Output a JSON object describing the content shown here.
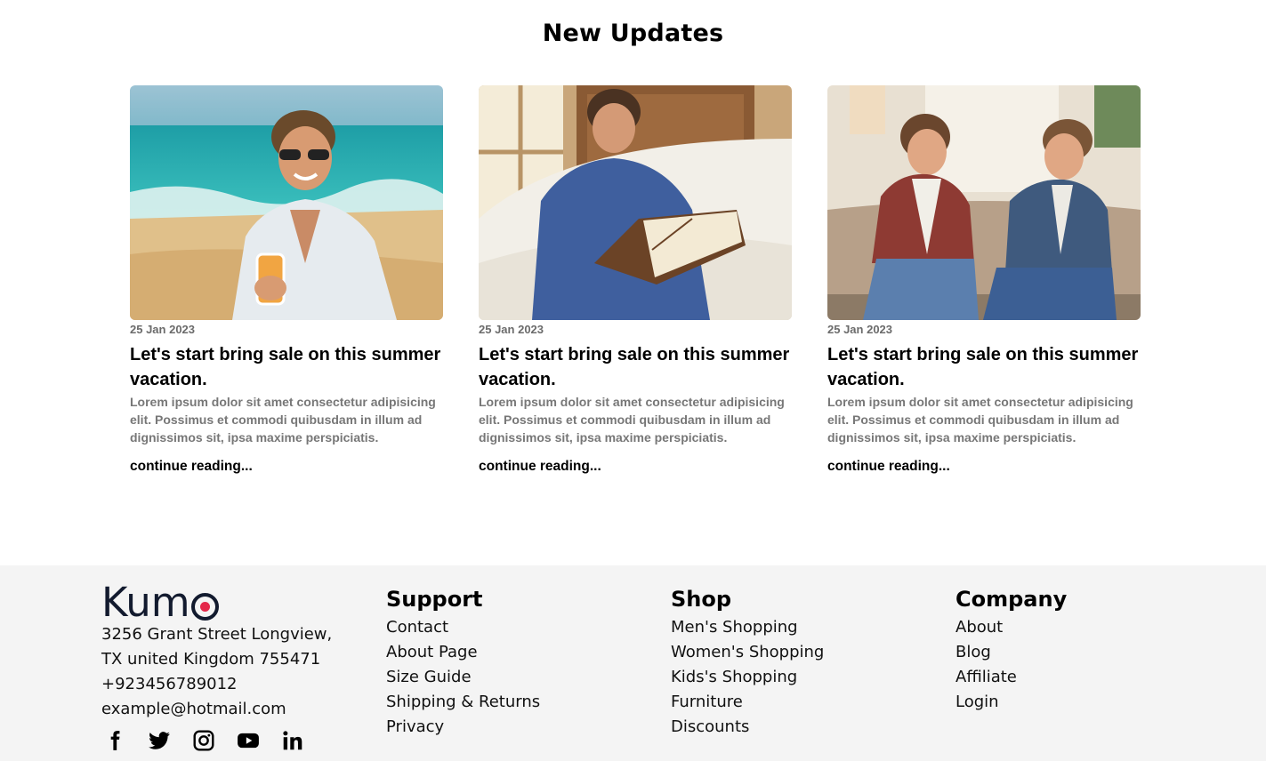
{
  "section": {
    "title": "New Updates"
  },
  "posts": [
    {
      "date": "25 Jan 2023",
      "title": "Let's start bring sale on this summer vacation.",
      "excerpt": "Lorem ipsum dolor sit amet consectetur adipisicing elit. Possimus et commodi quibusdam in illum ad dignissimos sit, ipsa maxime perspiciatis.",
      "link": "continue reading..."
    },
    {
      "date": "25 Jan 2023",
      "title": "Let's start bring sale on this summer vacation.",
      "excerpt": "Lorem ipsum dolor sit amet consectetur adipisicing elit. Possimus et commodi quibusdam in illum ad dignissimos sit, ipsa maxime perspiciatis.",
      "link": "continue reading..."
    },
    {
      "date": "25 Jan 2023",
      "title": "Let's start bring sale on this summer vacation.",
      "excerpt": "Lorem ipsum dolor sit amet consectetur adipisicing elit. Possimus et commodi quibusdam in illum ad dignissimos sit, ipsa maxime perspiciatis.",
      "link": "continue reading..."
    }
  ],
  "footer": {
    "brand": {
      "logo_text": "Kum",
      "address_line1": "3256 Grant Street Longview,",
      "address_line2": "TX united Kingdom 755471",
      "phone": "+923456789012",
      "email": "example@hotmail.com"
    },
    "socials": [
      "facebook-icon",
      "twitter-icon",
      "instagram-icon",
      "youtube-icon",
      "linkedin-icon"
    ],
    "support": {
      "heading": "Support",
      "links": [
        "Contact",
        "About Page",
        "Size Guide",
        "Shipping & Returns",
        "Privacy"
      ]
    },
    "shop": {
      "heading": "Shop",
      "links": [
        "Men's Shopping",
        "Women's Shopping",
        "Kids's Shopping",
        "Furniture",
        "Discounts"
      ]
    },
    "company": {
      "heading": "Company",
      "links": [
        "About",
        "Blog",
        "Affiliate",
        "Login"
      ]
    }
  },
  "colors": {
    "accent": "#e4284a",
    "brand_dark": "#121a2e",
    "footer_bg": "#f4f4f4",
    "muted_text": "#777777"
  }
}
